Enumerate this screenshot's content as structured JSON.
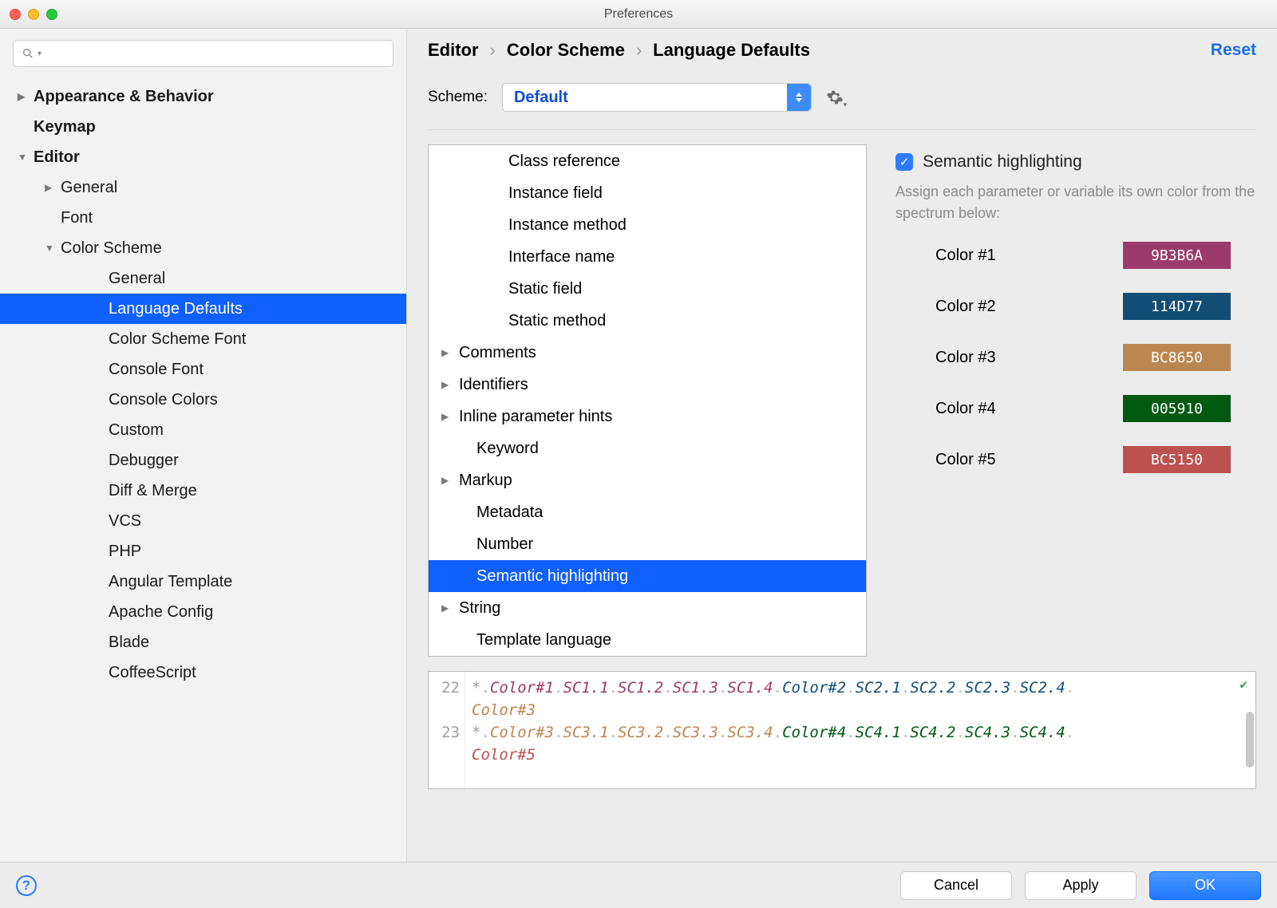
{
  "window": {
    "title": "Preferences"
  },
  "search": {
    "placeholder": ""
  },
  "sidebar": {
    "items": [
      {
        "label": "Appearance & Behavior",
        "depth": 0,
        "bold": true,
        "arrow": "▶"
      },
      {
        "label": "Keymap",
        "depth": 0,
        "bold": true,
        "arrow": ""
      },
      {
        "label": "Editor",
        "depth": 0,
        "bold": true,
        "arrow": "▼"
      },
      {
        "label": "General",
        "depth": 1,
        "arrow": "▶"
      },
      {
        "label": "Font",
        "depth": 1,
        "arrow": ""
      },
      {
        "label": "Color Scheme",
        "depth": 1,
        "arrow": "▼"
      },
      {
        "label": "General",
        "depth": 2,
        "arrow": ""
      },
      {
        "label": "Language Defaults",
        "depth": 2,
        "arrow": "",
        "selected": true
      },
      {
        "label": "Color Scheme Font",
        "depth": 2,
        "arrow": ""
      },
      {
        "label": "Console Font",
        "depth": 2,
        "arrow": ""
      },
      {
        "label": "Console Colors",
        "depth": 2,
        "arrow": ""
      },
      {
        "label": "Custom",
        "depth": 2,
        "arrow": ""
      },
      {
        "label": "Debugger",
        "depth": 2,
        "arrow": ""
      },
      {
        "label": "Diff & Merge",
        "depth": 2,
        "arrow": ""
      },
      {
        "label": "VCS",
        "depth": 2,
        "arrow": ""
      },
      {
        "label": "PHP",
        "depth": 2,
        "arrow": ""
      },
      {
        "label": "Angular Template",
        "depth": 2,
        "arrow": ""
      },
      {
        "label": "Apache Config",
        "depth": 2,
        "arrow": ""
      },
      {
        "label": "Blade",
        "depth": 2,
        "arrow": ""
      },
      {
        "label": "CoffeeScript",
        "depth": 2,
        "arrow": ""
      }
    ]
  },
  "breadcrumbs": [
    "Editor",
    "Color Scheme",
    "Language Defaults"
  ],
  "reset_label": "Reset",
  "scheme": {
    "label": "Scheme:",
    "value": "Default"
  },
  "attributes": [
    {
      "label": "Class reference",
      "indent": 2
    },
    {
      "label": "Instance field",
      "indent": 2
    },
    {
      "label": "Instance method",
      "indent": 2
    },
    {
      "label": "Interface name",
      "indent": 2
    },
    {
      "label": "Static field",
      "indent": 2
    },
    {
      "label": "Static method",
      "indent": 2
    },
    {
      "label": "Comments",
      "indent": 0,
      "arrow": "▶"
    },
    {
      "label": "Identifiers",
      "indent": 0,
      "arrow": "▶"
    },
    {
      "label": "Inline parameter hints",
      "indent": 0,
      "arrow": "▶"
    },
    {
      "label": "Keyword",
      "indent": 1
    },
    {
      "label": "Markup",
      "indent": 0,
      "arrow": "▶"
    },
    {
      "label": "Metadata",
      "indent": 1
    },
    {
      "label": "Number",
      "indent": 1
    },
    {
      "label": "Semantic highlighting",
      "indent": 1,
      "selected": true
    },
    {
      "label": "String",
      "indent": 0,
      "arrow": "▶"
    },
    {
      "label": "Template language",
      "indent": 1
    }
  ],
  "semantic": {
    "checkbox_label": "Semantic highlighting",
    "description": "Assign each parameter or variable its own color from the spectrum below:",
    "colors": [
      {
        "label": "Color #1",
        "hex": "9B3B6A",
        "bg": "#9b3b6a"
      },
      {
        "label": "Color #2",
        "hex": "114D77",
        "bg": "#114d77"
      },
      {
        "label": "Color #3",
        "hex": "BC8650",
        "bg": "#bc8650"
      },
      {
        "label": "Color #4",
        "hex": "005910",
        "bg": "#005910"
      },
      {
        "label": "Color #5",
        "hex": "BC5150",
        "bg": "#bc5150"
      }
    ]
  },
  "preview": {
    "lines": [
      "22",
      "23"
    ],
    "tokens_22": [
      "*",
      "Color#1",
      "SC1.1",
      "SC1.2",
      "SC1.3",
      "SC1.4",
      "Color#2",
      "SC2.1",
      "SC2.2",
      "SC2.3",
      "SC2.4",
      "Color#3"
    ],
    "tokens_23": [
      "*",
      "Color#3",
      "SC3.1",
      "SC3.2",
      "SC3.3",
      "SC3.4",
      "Color#4",
      "SC4.1",
      "SC4.2",
      "SC4.3",
      "SC4.4",
      "Color#5"
    ]
  },
  "footer": {
    "cancel": "Cancel",
    "apply": "Apply",
    "ok": "OK"
  }
}
